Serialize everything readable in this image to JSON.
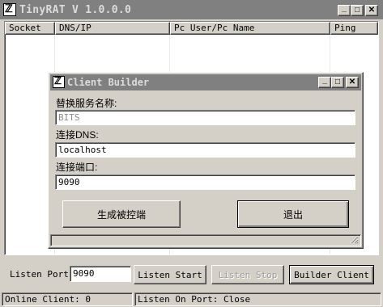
{
  "main": {
    "title": "TinyRAT V 1.0.0.0",
    "icon": "app-icon",
    "columns": [
      "Socket",
      "DNS/IP",
      "Pc User/Pc Name",
      "Ping"
    ]
  },
  "listen": {
    "port_label": "Listen Port:",
    "port_value": "9090",
    "start_label": "Listen Start",
    "stop_label": "Listen Stop",
    "builder_label": "Builder Client"
  },
  "status": {
    "online": "Online Client: 0",
    "port": "Listen On Port: Close"
  },
  "dialog": {
    "title": "Client Builder",
    "service_label": "替换服务名称:",
    "service_value": "BITS",
    "dns_label": "连接DNS:",
    "dns_value": "localhost",
    "port_label": "连接端口:",
    "port_value": "9090",
    "generate_label": "生成被控端",
    "exit_label": "退出"
  },
  "window_buttons": {
    "minimize": "_",
    "maximize": "□",
    "close": "✕"
  },
  "colors": {
    "inactive_titlebar": "#808080",
    "face": "#d4d0c8"
  }
}
